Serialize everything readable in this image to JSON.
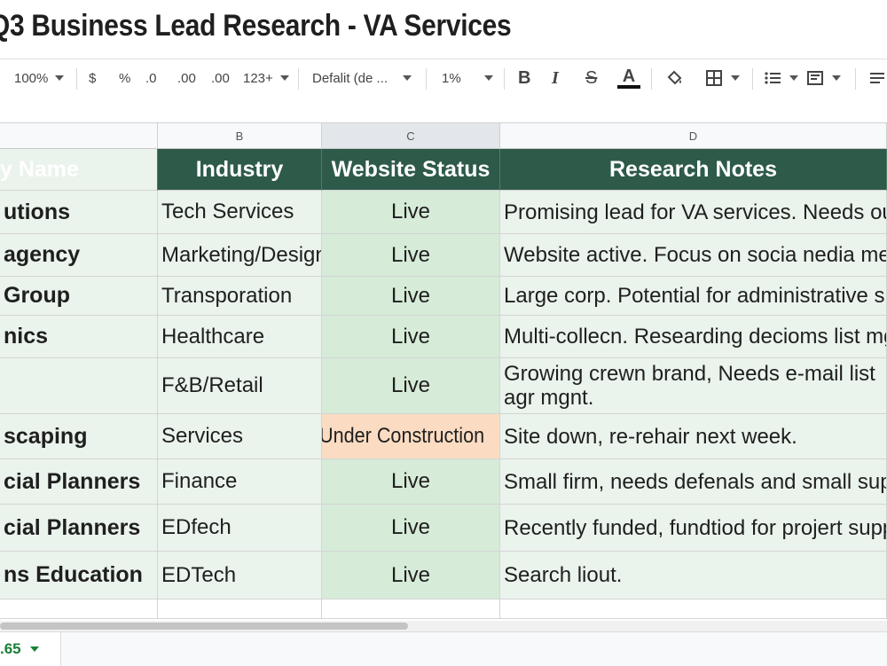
{
  "doc": {
    "title": "Q3 Business Lead Research - VA Services"
  },
  "toolbar": {
    "zoom": "100%",
    "currency": "$",
    "percent": "%",
    "decrease_decimal": ".0",
    "increase_decimal": ".00",
    "decimal_alt": ".00",
    "more_formats": "123+",
    "font": "Defalit (de ...",
    "font_size": "1%",
    "bold": "B",
    "italic": "I",
    "strike": "S",
    "text_color": "A"
  },
  "columns": [
    {
      "letter": ""
    },
    {
      "letter": "B"
    },
    {
      "letter": "C"
    },
    {
      "letter": "D"
    }
  ],
  "table": {
    "headers": [
      "y Name",
      "Industry",
      "Website Status",
      "Research Notes"
    ],
    "rows": [
      {
        "name": "utions",
        "industry": "Tech Services",
        "status": "Live",
        "notes": "Promising lead for VA services. Needs outr"
      },
      {
        "name": "agency",
        "industry": "Marketing/Design",
        "status": "Live",
        "notes": "Website active. Focus on socia nedia meg"
      },
      {
        "name": " Group",
        "industry": "Transporation",
        "status": "Live",
        "notes": "Large corp. Potential for administrative sup"
      },
      {
        "name": "nics",
        "industry": "Healthcare",
        "status": "Live",
        "notes": "Multi-collecn. Researding decioms list mgr"
      },
      {
        "name": "",
        "industry": "F&B/Retail",
        "status": "Live",
        "notes": "Growing crewn brand, Needs e-mail list agr mgnt."
      },
      {
        "name": "scaping",
        "industry": "Services",
        "status": "Under Construction",
        "notes": "Site down, re-rehair next week."
      },
      {
        "name": "cial Planners",
        "industry": "Finance",
        "status": "Live",
        "notes": "Small firm, needs defenals and small suppo"
      },
      {
        "name": "cial Planners",
        "industry": "EDfech",
        "status": "Live",
        "notes": "Recently funded, fundtiod for projert suppo"
      },
      {
        "name": "ns Education",
        "industry": "EDTech",
        "status": "Live",
        "notes": "Search liout."
      }
    ]
  },
  "status_colors": {
    "live": "#d6ebd8",
    "under_construction": "#fbdcc2",
    "header": "#2e5a4a"
  },
  "sheet_tab": {
    "label": ".65"
  }
}
